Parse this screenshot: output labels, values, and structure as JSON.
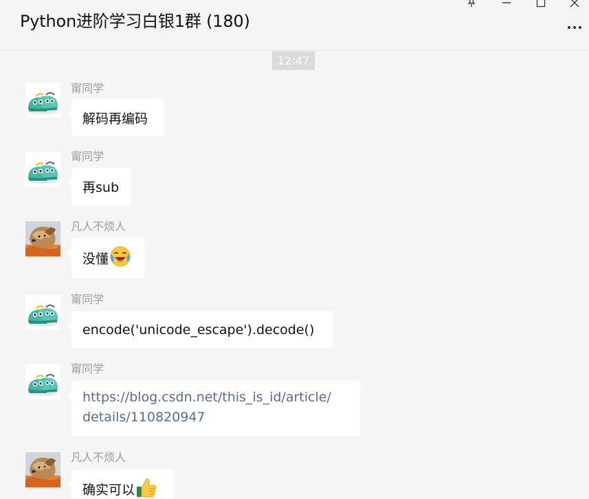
{
  "window": {
    "title": "Python进阶学习白银1群 (180)"
  },
  "timestamp": "12:47",
  "messages": [
    {
      "sender": "甯同学",
      "text": "解码再编码",
      "avatar": "shoes-avatar-icon"
    },
    {
      "sender": "甯同学",
      "text": "再sub",
      "avatar": "shoes-avatar-icon"
    },
    {
      "sender": "凡人不烦人",
      "text": "没懂",
      "emoji": "crying-laughing-emoji-icon",
      "avatar": "dog-avatar-icon"
    },
    {
      "sender": "甯同学",
      "text": "encode('unicode_escape').decode()",
      "avatar": "shoes-avatar-icon"
    },
    {
      "sender": "甯同学",
      "text_line1": "https://blog.csdn.net/this_is_id/article/",
      "text_line2": "details/110820947",
      "avatar": "shoes-avatar-icon"
    },
    {
      "sender": "凡人不烦人",
      "text": "确实可以",
      "emoji": "thumbs-up-emoji-icon",
      "avatar": "dog-avatar-icon"
    }
  ],
  "colors": {
    "background": "#f5f5f5",
    "bubble": "#ffffff",
    "link": "#576b95",
    "timestamp_bg": "#dadada",
    "sender": "#9e9e9e"
  }
}
